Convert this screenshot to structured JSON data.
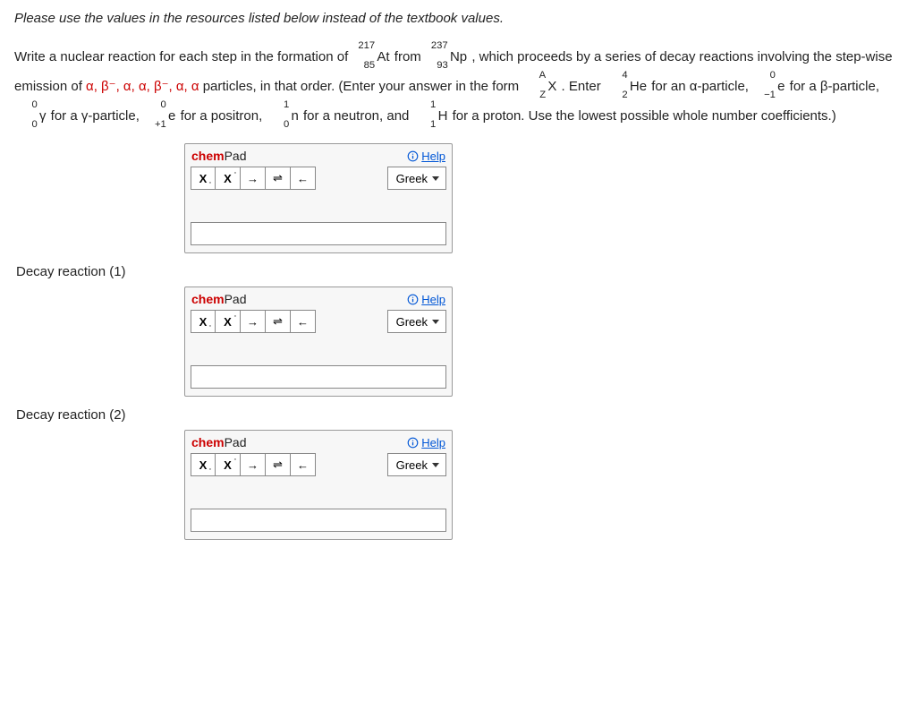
{
  "instructions_note": "Please use the values in the resources listed below instead of the textbook values.",
  "question": {
    "intro": "Write a nuclear reaction for each step in the formation of ",
    "product": {
      "mass": "217",
      "atomic": "85",
      "symbol": "At"
    },
    "from_word": " from ",
    "source": {
      "mass": "237",
      "atomic": "93",
      "symbol": "Np"
    },
    "after_source": ", which proceeds by a series of decay reactions involving the step-wise emission of ",
    "particles_list": "α, β⁻, α, α, β⁻, α, α",
    "after_particles": " particles, in that order. (Enter your answer in the form ",
    "form": {
      "mass": "A",
      "atomic": "Z",
      "symbol": "X"
    },
    "after_form": ". Enter ",
    "particle_defs": [
      {
        "nuc": {
          "mass": "4",
          "atomic": "2",
          "symbol": "He"
        },
        "label": " for an α-particle, "
      },
      {
        "nuc": {
          "mass": "0",
          "atomic": "−1",
          "symbol": "e"
        },
        "label": " for a β-particle, "
      },
      {
        "nuc": {
          "mass": "0",
          "atomic": "0",
          "symbol": "γ"
        },
        "label": " for a γ-particle, "
      },
      {
        "nuc": {
          "mass": "0",
          "atomic": "+1",
          "symbol": "e"
        },
        "label": " for a positron, "
      },
      {
        "nuc": {
          "mass": "1",
          "atomic": "0",
          "symbol": "n"
        },
        "label": " for a neutron, and "
      },
      {
        "nuc": {
          "mass": "1",
          "atomic": "1",
          "symbol": "H"
        },
        "label": " for a proton. "
      }
    ],
    "trailing": "Use the lowest possible whole number coefficients.)"
  },
  "chempad": {
    "title_red": "chem",
    "title_black": "Pad",
    "help": "Help",
    "greek": "Greek",
    "buttons": {
      "sub": "X",
      "sup": "X",
      "arrow_r": "→",
      "equil": "⇌",
      "arrow_l": "←"
    }
  },
  "labels": {
    "decay1": "Decay reaction (1)",
    "decay2": "Decay reaction (2)"
  }
}
